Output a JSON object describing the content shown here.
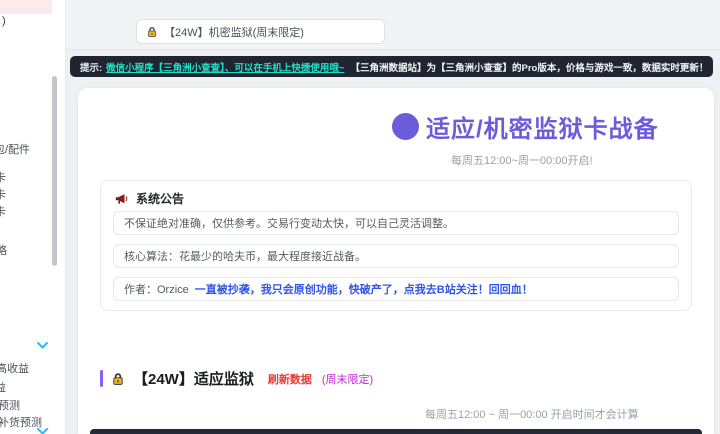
{
  "sidebar": {
    "partial_top_fragment": ")",
    "items": [
      {
        "label": "包/配件"
      },
      {
        "label": "卡"
      },
      {
        "label": "卡"
      },
      {
        "label": "卡"
      },
      {
        "label": "略"
      },
      {
        "label": "高收益"
      },
      {
        "label": "益"
      },
      {
        "label": "预测"
      },
      {
        "label": "补货预测"
      }
    ]
  },
  "topbar": {
    "tab_label": "【24W】机密监狱(周末限定)"
  },
  "notice": {
    "prefix": "提示:",
    "link": "微信小程序【三角洲小查查】、可以在手机上快捷使用哦~",
    "rest": "【三角洲数据站】为【三角洲小查查】的Pro版本，价格与游戏一致，数据实时更新！"
  },
  "hero": {
    "title": "适应/机密监狱卡战备",
    "subtitle": "每周五12:00~周一00:00开启!"
  },
  "announcement": {
    "header": "系统公告",
    "row1": "不保证绝对准确，仅供参考。交易行变动太快，可以自己灵活调整。",
    "row2": "核心算法：花最少的哈夫币，最大程度接近战备。",
    "author_prefix": "作者：Orzice",
    "author_link": "一直被抄袭，我只会原创功能，快破产了，点我去B站关注！回回血！"
  },
  "section": {
    "title": "【24W】适应监狱",
    "refresh_label": "刷新数据",
    "badge": "(周末限定)",
    "schedule_note": "每周五12:00 ~ 周一00:00 开启时间才会计算"
  },
  "colors": {
    "accent_purple": "#6c5cd9",
    "notice_bg": "#202531",
    "notice_link_teal": "#21e0c6",
    "refresh_red": "#e53935",
    "badge_magenta": "#c026d3",
    "author_link_blue": "#2f54eb",
    "active_item_pink": "#fdeaea",
    "chevron_blue": "#2fb9f2"
  }
}
